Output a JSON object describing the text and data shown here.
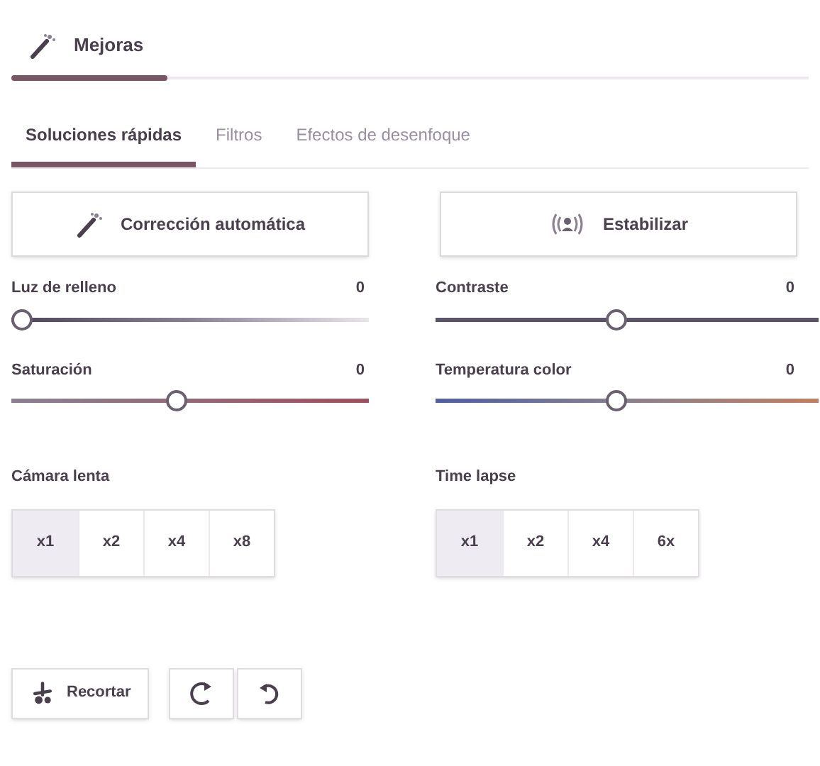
{
  "header": {
    "title": "Mejoras"
  },
  "tabs": [
    {
      "label": "Soluciones rápidas",
      "selected": true
    },
    {
      "label": "Filtros",
      "selected": false
    },
    {
      "label": "Efectos de desenfoque",
      "selected": false
    }
  ],
  "actions": [
    {
      "label": "Corrección automática",
      "kind": "wand"
    },
    {
      "label": "Estabilizar",
      "kind": "stabilize"
    }
  ],
  "sliders": [
    {
      "label": "Luz de relleno",
      "reading": "0",
      "level": 0,
      "kind": "fade"
    },
    {
      "label": "Contraste",
      "reading": "0",
      "level": 0.47,
      "kind": "plain"
    },
    {
      "label": "Saturación",
      "reading": "0",
      "level": 0.46,
      "kind": "saturation"
    },
    {
      "label": "Temperatura color",
      "reading": "0",
      "level": 0.47,
      "kind": "temperature"
    }
  ],
  "speed_groups": [
    {
      "label": "Cámara lenta",
      "options": [
        {
          "label": "x1",
          "selected": true
        },
        {
          "label": "x2",
          "selected": false
        },
        {
          "label": "x4",
          "selected": false
        },
        {
          "label": "x8",
          "selected": false
        }
      ]
    },
    {
      "label": "Time lapse",
      "options": [
        {
          "label": "x1",
          "selected": true
        },
        {
          "label": "x2",
          "selected": false
        },
        {
          "label": "x4",
          "selected": false
        },
        {
          "label": "6x",
          "selected": false
        }
      ]
    }
  ],
  "toolbar": [
    {
      "label": "Recortar",
      "kind": "trim"
    },
    {
      "kind": "rotate-right"
    },
    {
      "kind": "rotate-left"
    }
  ]
}
